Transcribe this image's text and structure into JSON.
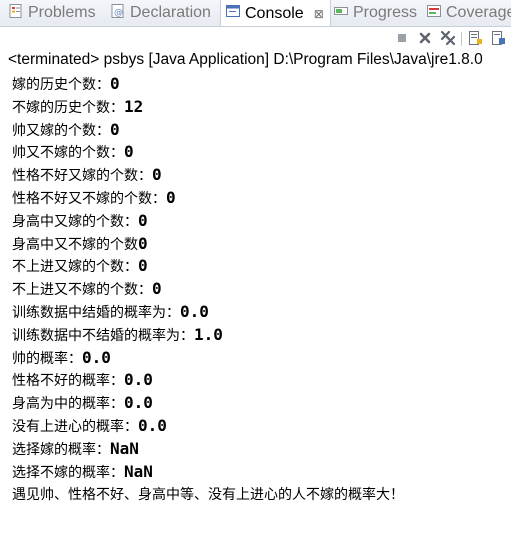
{
  "tabs": [
    {
      "label": "Problems",
      "icon": "problems-icon",
      "active": false
    },
    {
      "label": "Declaration",
      "icon": "declaration-icon",
      "active": false
    },
    {
      "label": "Console",
      "icon": "console-icon",
      "active": true
    },
    {
      "label": "Progress",
      "icon": "progress-icon",
      "active": false
    },
    {
      "label": "Coverage",
      "icon": "coverage-icon",
      "active": false
    }
  ],
  "close_glyph": "⊠",
  "toolbar": [
    "stop-icon",
    "remove-launch-icon",
    "remove-all-terminated-icon",
    "scroll-lock-icon",
    "pin-console-icon"
  ],
  "console": {
    "header": "<terminated> psbys [Java Application] D:\\Program Files\\Java\\jre1.8.0",
    "lines": [
      {
        "label": "嫁的历史个数：",
        "value": "0"
      },
      {
        "label": "不嫁的历史个数：",
        "value": "12"
      },
      {
        "label": "帅又嫁的个数：",
        "value": "0"
      },
      {
        "label": "帅又不嫁的个数：",
        "value": "0"
      },
      {
        "label": "性格不好又嫁的个数：",
        "value": "0"
      },
      {
        "label": "性格不好又不嫁的个数：",
        "value": "0"
      },
      {
        "label": "身高中又嫁的个数：",
        "value": "0"
      },
      {
        "label": "身高中又不嫁的个数",
        "value": "0"
      },
      {
        "label": "不上进又嫁的个数：",
        "value": "0"
      },
      {
        "label": "不上进又不嫁的个数：",
        "value": "0"
      },
      {
        "label": "训练数据中结婚的概率为：",
        "value": "0.0"
      },
      {
        "label": "训练数据中不结婚的概率为：",
        "value": "1.0"
      },
      {
        "label": "帅的概率：",
        "value": "0.0"
      },
      {
        "label": "性格不好的概率：",
        "value": "0.0"
      },
      {
        "label": "身高为中的概率：",
        "value": "0.0"
      },
      {
        "label": "没有上进心的概率：",
        "value": "0.0"
      },
      {
        "label": "选择嫁的概率：",
        "value": "NaN"
      },
      {
        "label": "选择不嫁的概率：",
        "value": "NaN"
      },
      {
        "label": "遇见帅、性格不好、身高中等、没有上进心的人不嫁的概率大！",
        "value": ""
      }
    ]
  }
}
